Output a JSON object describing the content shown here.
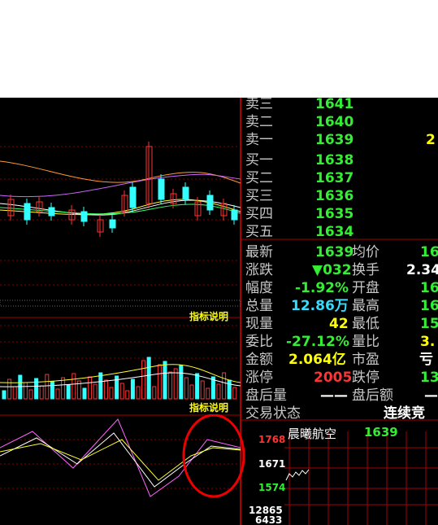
{
  "order_book": {
    "asks": [
      {
        "label": "卖三",
        "price": "1641"
      },
      {
        "label": "卖二",
        "price": "1640"
      },
      {
        "label": "卖一",
        "price": "1639",
        "volume": "2"
      }
    ],
    "bids": [
      {
        "label": "买一",
        "price": "1638"
      },
      {
        "label": "买二",
        "price": "1637"
      },
      {
        "label": "买三",
        "price": "1636"
      },
      {
        "label": "买四",
        "price": "1635"
      },
      {
        "label": "买五",
        "price": "1634"
      }
    ]
  },
  "quote": {
    "latest_label": "最新",
    "latest": "1639",
    "avg_label": "均价",
    "avg": "16",
    "change_label": "涨跌",
    "change": "▼032",
    "turnover_label": "换手",
    "turnover": "2.34",
    "pct_label": "幅度",
    "pct": "-1.92%",
    "open_label": "开盘",
    "open": "16",
    "volume_label": "总量",
    "volume": "12.86万",
    "high_label": "最高",
    "high": "16",
    "current_label": "现量",
    "current": "42",
    "low_label": "最低",
    "low": "15",
    "weibi_label": "委比",
    "weibi": "-27.12%",
    "liangbi_label": "量比",
    "liangbi": "3.",
    "amount_label": "金额",
    "amount": "2.064亿",
    "pe_label": "市盈",
    "pe": "亏",
    "limit_up_label": "涨停",
    "limit_up": "2005",
    "limit_down_label": "跌停",
    "limit_down": "13",
    "after_vol_label": "盘后量",
    "after_vol": "——",
    "after_amt_label": "盘后额",
    "after_amt": "—",
    "status_label": "交易状态",
    "status": "连续竞"
  },
  "indicator_label": "指标说明",
  "kdj_axis": {
    "top": "1768",
    "mid": "1671",
    "low": "1574"
  },
  "mini_chart": {
    "title": "晨曦航空",
    "price": "1639",
    "vol_top": "12865",
    "vol_mid": "6433"
  },
  "colors": {
    "up": "#ff3333",
    "down": "#33ffff",
    "text_green": "#33ee33",
    "border_red": "#aa0000",
    "circle": "#ee0000"
  }
}
